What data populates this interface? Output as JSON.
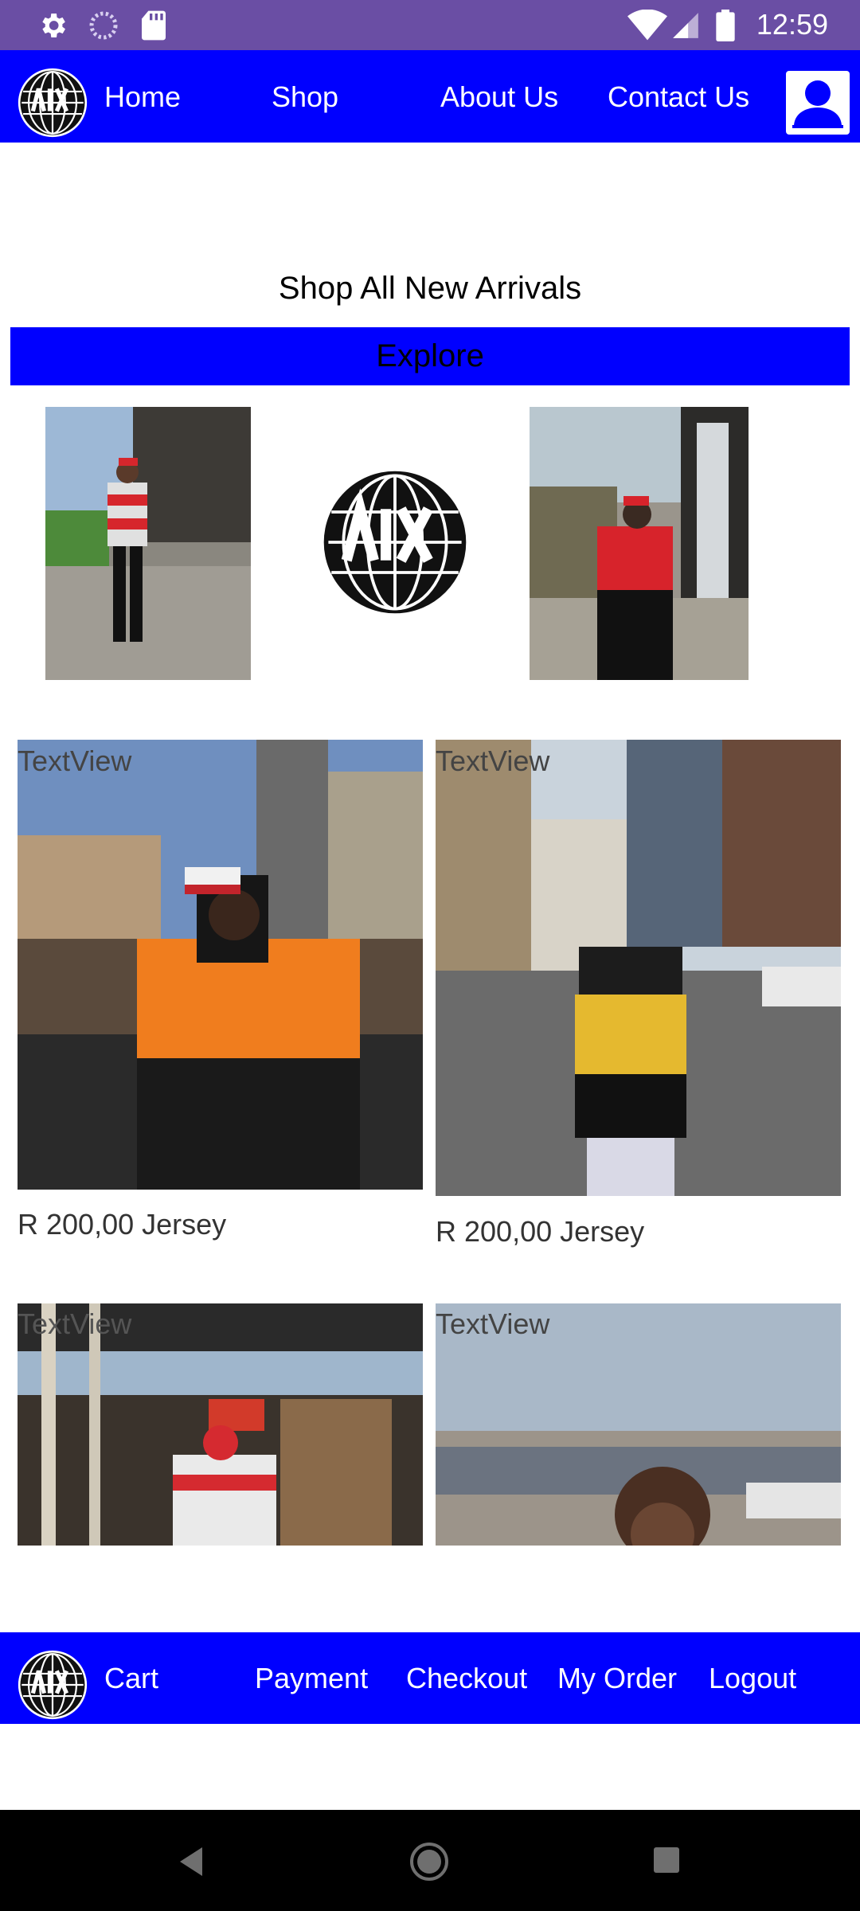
{
  "status_bar": {
    "time": "12:59",
    "icons": [
      "settings-icon",
      "sync-icon",
      "sd-card-icon",
      "wifi-icon",
      "signal-icon",
      "battery-icon"
    ]
  },
  "top_nav": {
    "items": [
      {
        "label": "Home"
      },
      {
        "label": "Shop"
      },
      {
        "label": "About Us"
      },
      {
        "label": "Contact Us"
      }
    ],
    "profile_icon": "profile-icon",
    "logo_icon": "basic-globe-logo"
  },
  "main": {
    "heading": "Shop All New Arrivals",
    "explore_label": "Explore",
    "products": [
      {
        "textview": "TextView",
        "price": "R 200,00 Jersey"
      },
      {
        "textview": "TextView",
        "price": "R 200,00 Jersey"
      },
      {
        "textview": "TextView"
      },
      {
        "textview": "TextView"
      }
    ]
  },
  "bottom_nav": {
    "items": [
      {
        "label": "Cart"
      },
      {
        "label": "Payment"
      },
      {
        "label": "Checkout"
      },
      {
        "label": "My Order"
      },
      {
        "label": "Logout"
      }
    ]
  },
  "system_nav": {
    "icons": [
      "back-icon",
      "home-icon",
      "recents-icon"
    ]
  },
  "colors": {
    "status_bar": "#6a4ea4",
    "accent_blue": "#0000ff",
    "text_white": "#ffffff"
  }
}
